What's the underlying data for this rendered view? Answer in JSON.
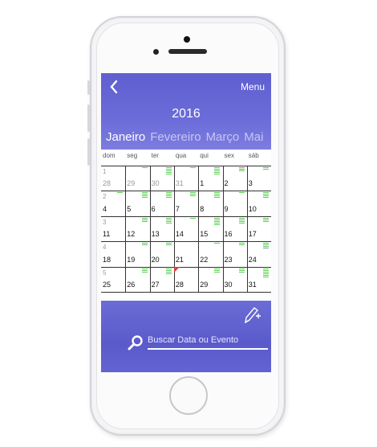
{
  "header": {
    "back_label": "‹",
    "menu_label": "Menu",
    "year": "2016",
    "months": [
      "Janeiro",
      "Fevereiro",
      "Março",
      "Mai"
    ],
    "active_month": 0
  },
  "calendar": {
    "weekdays": [
      "dom",
      "seg",
      "ter",
      "qua",
      "qui",
      "sex",
      "sáb"
    ],
    "weeks": [
      [
        {
          "n": "28",
          "muted": true,
          "small": "1"
        },
        {
          "n": "29",
          "muted": true
        },
        {
          "n": "30",
          "muted": true
        },
        {
          "n": "31",
          "muted": true
        },
        {
          "n": "1"
        },
        {
          "n": "2"
        },
        {
          "n": "3"
        }
      ],
      [
        {
          "n": "4",
          "small": "2"
        },
        {
          "n": "5"
        },
        {
          "n": "6"
        },
        {
          "n": "7"
        },
        {
          "n": "8"
        },
        {
          "n": "9"
        },
        {
          "n": "10"
        }
      ],
      [
        {
          "n": "11",
          "small": "3"
        },
        {
          "n": "12"
        },
        {
          "n": "13"
        },
        {
          "n": "14"
        },
        {
          "n": "15"
        },
        {
          "n": "16"
        },
        {
          "n": "17"
        }
      ],
      [
        {
          "n": "18",
          "small": "4"
        },
        {
          "n": "19"
        },
        {
          "n": "20"
        },
        {
          "n": "21"
        },
        {
          "n": "22"
        },
        {
          "n": "23"
        },
        {
          "n": "24"
        }
      ],
      [
        {
          "n": "25",
          "small": "5"
        },
        {
          "n": "26"
        },
        {
          "n": "27"
        },
        {
          "n": "28",
          "today": true
        },
        {
          "n": "29"
        },
        {
          "n": "30"
        },
        {
          "n": "31"
        }
      ]
    ]
  },
  "footer": {
    "search_placeholder": "Buscar Data ou Evento",
    "search_icon": "search-icon",
    "add_event_icon": "pencil-plus-icon"
  },
  "colors": {
    "header_bg": "#6464d4",
    "event_green": "#5ccf55",
    "event_blue": "#7f8bd8",
    "today_marker": "#e53935"
  }
}
